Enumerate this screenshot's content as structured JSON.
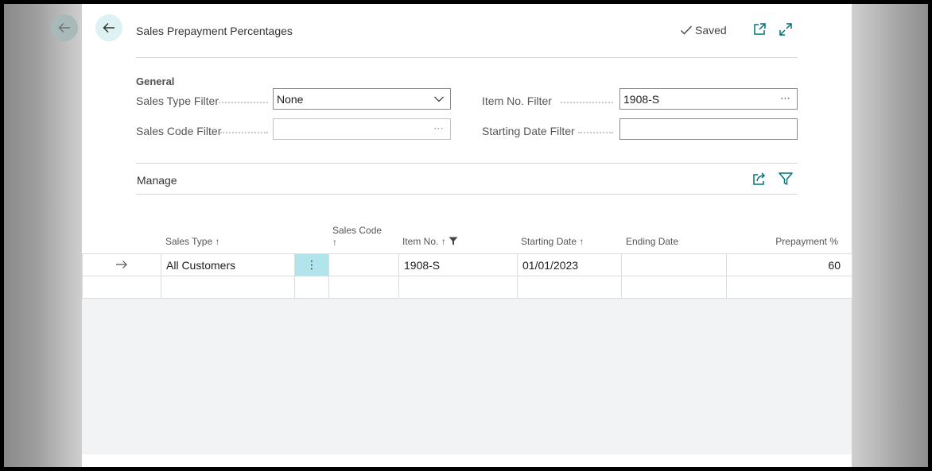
{
  "header": {
    "title": "Sales Prepayment Percentages",
    "saved_label": "Saved"
  },
  "general": {
    "section_title": "General",
    "sales_type_filter": {
      "label": "Sales Type Filter",
      "value": "None"
    },
    "sales_code_filter": {
      "label": "Sales Code Filter",
      "value": ""
    },
    "item_no_filter": {
      "label": "Item No. Filter",
      "value": "1908-S"
    },
    "starting_date_filter": {
      "label": "Starting Date Filter",
      "value": ""
    }
  },
  "manage": {
    "label": "Manage"
  },
  "table": {
    "columns": {
      "sales_type": "Sales Type",
      "sales_code": "Sales Code",
      "item_no": "Item No.",
      "starting_date": "Starting Date",
      "ending_date": "Ending Date",
      "prepayment_pct": "Prepayment %"
    },
    "rows": [
      {
        "sales_type": "All Customers",
        "sales_code": "",
        "item_no": "1908-S",
        "starting_date": "01/01/2023",
        "ending_date": "",
        "prepayment_pct": "60"
      }
    ]
  },
  "icons": {
    "back": "arrow-left-icon",
    "saved": "checkmark-icon",
    "open_new_window": "open-in-new-window-icon",
    "expand": "expand-icon",
    "share": "share-icon",
    "filter": "filter-icon",
    "sort_up": "arrow-up-icon",
    "row_menu": "vertical-ellipsis-icon",
    "row_arrow": "arrow-right-icon",
    "dropdown": "chevron-down-icon",
    "lookup": "ellipsis-icon"
  },
  "colors": {
    "accent": "#00727a",
    "selected_cell": "#b2e4ec",
    "back_button_bg": "#dff2f3"
  }
}
